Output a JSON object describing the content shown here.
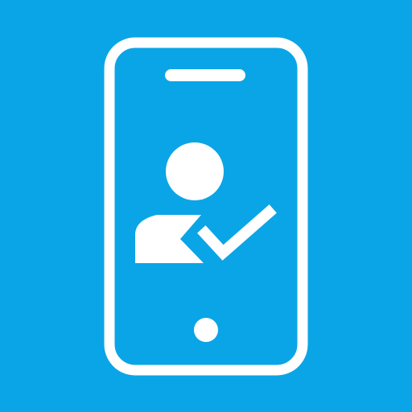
{
  "icon": {
    "name": "phone-user-verified-icon",
    "colors": {
      "background": "#0aa5e6",
      "foreground": "#ffffff"
    },
    "parts": [
      "phone-outline",
      "speaker-slot",
      "user-silhouette",
      "checkmark",
      "home-button"
    ]
  }
}
